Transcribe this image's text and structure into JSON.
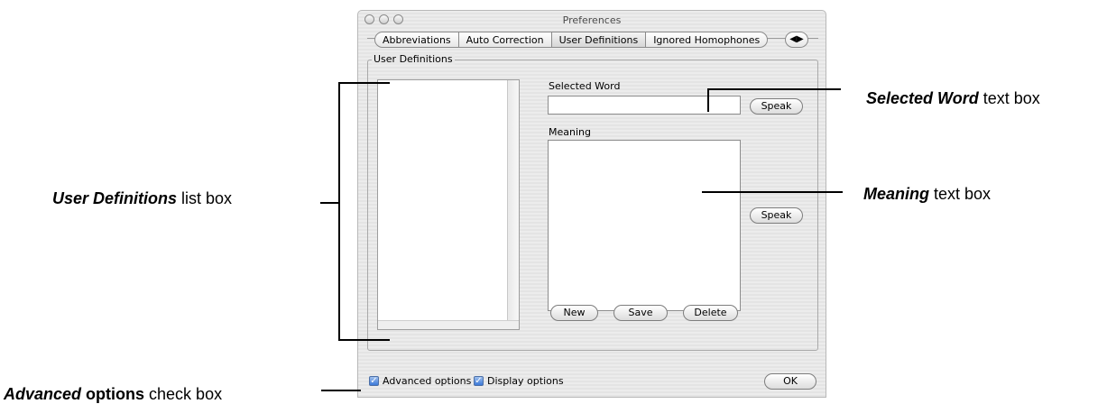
{
  "window": {
    "title": "Preferences",
    "tabs": [
      "Abbreviations",
      "Auto Correction",
      "User Definitions",
      "Ignored Homophones"
    ],
    "tab_scroll_glyph": "◀▶"
  },
  "group": {
    "label": "User Definitions"
  },
  "form": {
    "selected_word_label": "Selected Word",
    "selected_word_value": "",
    "meaning_label": "Meaning",
    "meaning_value": "",
    "speak_label": "Speak",
    "new_label": "New",
    "save_label": "Save",
    "delete_label": "Delete"
  },
  "footer": {
    "advanced_label": "Advanced options",
    "display_label": "Display options",
    "ok_label": "OK",
    "advanced_checked": true,
    "display_checked": true
  },
  "callouts": {
    "selected_word": {
      "em": "Selected Word",
      "rest": " text box"
    },
    "meaning": {
      "em": "Meaning",
      "rest": " text box"
    },
    "user_definitions": {
      "em": "User Definitions",
      "rest": " list box"
    },
    "advanced": {
      "em": "Advanced",
      "rest": " options",
      "tail": " check box"
    }
  }
}
